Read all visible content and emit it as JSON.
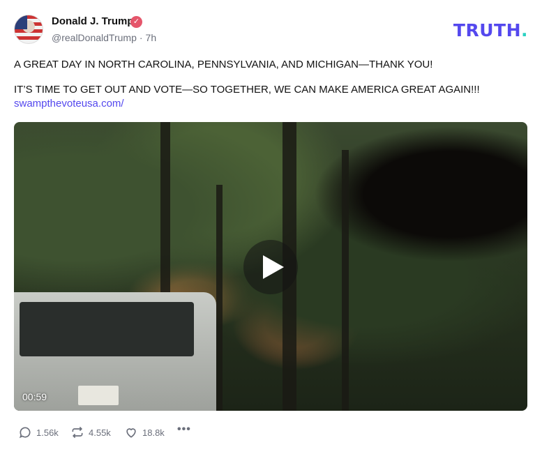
{
  "author": {
    "name": "Donald J. Trump",
    "handle": "@realDonaldTrump",
    "time_ago": "7h",
    "verified": true
  },
  "brand": {
    "logo_text": "TRUTH",
    "logo_period": ".",
    "color": "#5448ee"
  },
  "post": {
    "line1": "A GREAT DAY IN NORTH CAROLINA, PENNSYLVANIA, AND MICHIGAN—THANK YOU!",
    "line2": "IT’S TIME TO GET OUT AND VOTE—SO TOGETHER, WE CAN MAKE AMERICA GREAT AGAIN!!!",
    "link": "swampthevoteusa.com/"
  },
  "video": {
    "duration": "00:59",
    "play_icon": "play-icon"
  },
  "actions": {
    "replies": "1.56k",
    "retruths": "4.55k",
    "likes": "18.8k",
    "more": "•••"
  }
}
